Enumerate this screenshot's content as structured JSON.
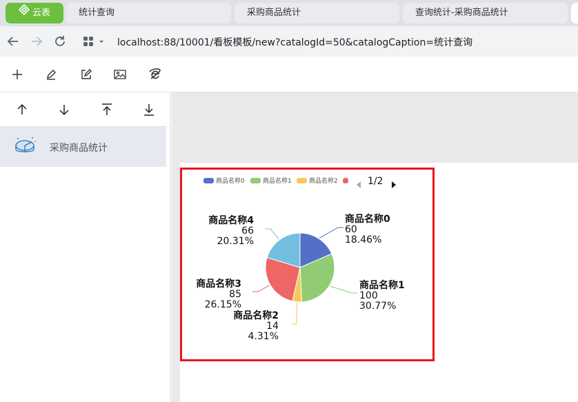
{
  "browser": {
    "brand_tab": "云表",
    "tabs": [
      "统计查询",
      "采购商品统计",
      "查询统计-采购商品统计"
    ],
    "url": "localhost:88/10001/看板模板/new?catalogId=50&catalogCaption=统计查询"
  },
  "toolbar": {
    "icons": [
      "add-icon",
      "edit-pencil-icon",
      "edit-note-icon",
      "image-icon",
      "ie-browser-icon"
    ]
  },
  "sidebar": {
    "sort_icons": [
      "move-up-icon",
      "move-down-icon",
      "move-top-icon",
      "move-bottom-icon"
    ],
    "items": [
      {
        "label": "采购商品统计"
      }
    ]
  },
  "chart_data": {
    "type": "pie",
    "title": "",
    "legend": {
      "placement": "top",
      "visible_entries": [
        "商品名称0",
        "商品名称1",
        "商品名称2"
      ],
      "page": "1/2"
    },
    "slices": [
      {
        "name": "商品名称0",
        "value": 60,
        "percent": "18.46%",
        "color": "#5470c6"
      },
      {
        "name": "商品名称1",
        "value": 100,
        "percent": "30.77%",
        "color": "#91cc75"
      },
      {
        "name": "商品名称2",
        "value": 14,
        "percent": "4.31%",
        "color": "#fac858"
      },
      {
        "name": "商品名称3",
        "value": 85,
        "percent": "26.15%",
        "color": "#ee6666"
      },
      {
        "name": "商品名称4",
        "value": 66,
        "percent": "20.31%",
        "color": "#73c0de"
      }
    ]
  }
}
